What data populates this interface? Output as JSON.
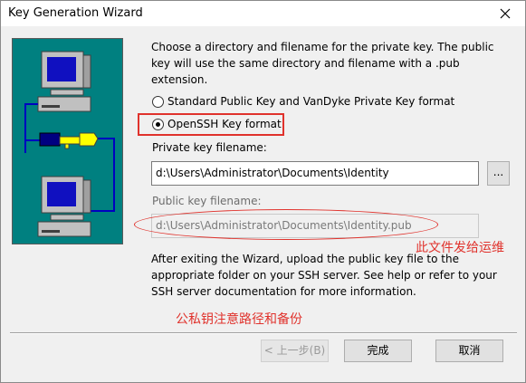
{
  "window": {
    "title": "Key Generation Wizard"
  },
  "intro_text": "Choose a directory and filename for the private key. The public key will use the same directory and filename with a .pub extension.",
  "key_format": {
    "option1_label": "Standard Public Key and VanDyke Private Key format",
    "option2_label": "OpenSSH Key format",
    "selected": "OpenSSH Key format"
  },
  "private_key": {
    "label": "Private key filename:",
    "value": "d:\\Users\\Administrator\\Documents\\Identity",
    "browse_label": "..."
  },
  "public_key": {
    "label": "Public key filename:",
    "value": "d:\\Users\\Administrator\\Documents\\Identity.pub"
  },
  "outro_text": "After exiting the Wizard, upload the public key file to the appropriate folder on your SSH server.  See help or refer to your SSH server documentation for more information.",
  "annotations": {
    "note_public": "此文件发给运维",
    "note_private": "公私钥注意路径和备份",
    "highlight_color": "#e0322c"
  },
  "buttons": {
    "back": "< 上一步(B)",
    "finish": "完成",
    "cancel": "取消"
  },
  "icons": {
    "close": "close-icon",
    "artwork": "computers-key-illustration"
  },
  "colors": {
    "art_background": "#008080",
    "window_background": "#f0f0f0"
  }
}
